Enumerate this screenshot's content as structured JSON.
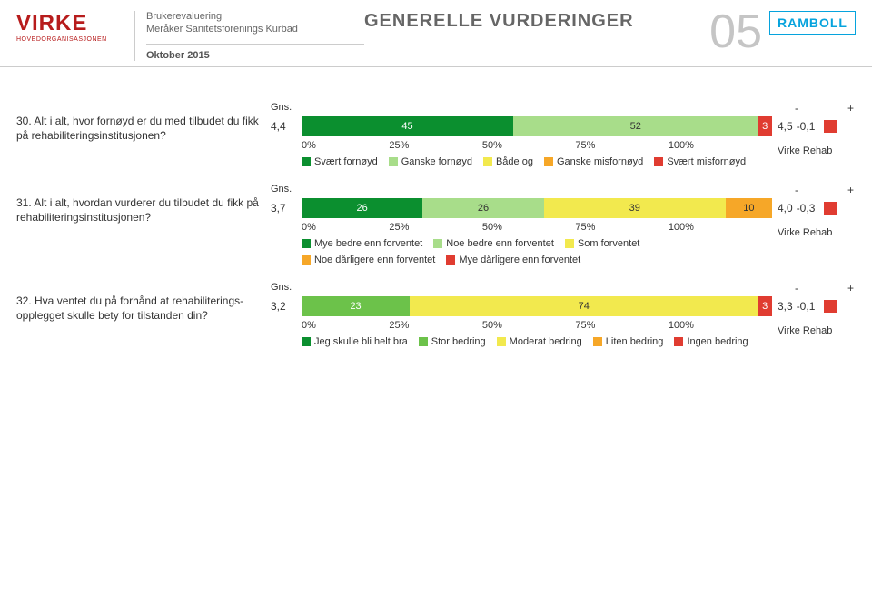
{
  "header": {
    "logo_top": "VIRKE",
    "logo_sub": "HOVEDORGANISASJONEN",
    "line1": "Brukerevaluering",
    "line2": "Meråker Sanitetsforenings Kurbad",
    "line3": "Oktober 2015",
    "title": "GENERELLE VURDERINGER",
    "page_number": "05",
    "ramboll": "RAMBOLL"
  },
  "axis_ticks": [
    "0%",
    "25%",
    "50%",
    "75%",
    "100%"
  ],
  "gns_label": "Gns.",
  "compare_label": "Virke Rehab",
  "pm": {
    "minus": "-",
    "plus": "+"
  },
  "questions": [
    {
      "label": "30. Alt i alt, hvor fornøyd er du med tilbudet du fikk på rehabiliteringsinstitusjonen?",
      "avg": "4,4",
      "cmp_avg": "4,5",
      "diff": "-0,1",
      "diff_color": "#e03c31",
      "segments": [
        {
          "value": 45,
          "color": "c-darkgreen",
          "txt": "45"
        },
        {
          "value": 52,
          "color": "c-lightgreen",
          "txt": "52",
          "dark": true
        },
        {
          "value": 3,
          "color": "c-red",
          "txt": "3"
        }
      ],
      "legend": [
        {
          "color": "c-darkgreen",
          "label": "Svært fornøyd"
        },
        {
          "color": "c-lightgreen",
          "label": "Ganske fornøyd"
        },
        {
          "color": "c-yellow",
          "label": "Både og"
        },
        {
          "color": "c-orange",
          "label": "Ganske misfornøyd"
        },
        {
          "color": "c-red",
          "label": "Svært misfornøyd"
        }
      ]
    },
    {
      "label": "31. Alt i alt, hvordan vurderer du tilbudet du fikk på rehabiliteringsinstitusjonen?",
      "avg": "3,7",
      "cmp_avg": "4,0",
      "diff": "-0,3",
      "diff_color": "#e03c31",
      "segments": [
        {
          "value": 26,
          "color": "c-darkgreen",
          "txt": "26"
        },
        {
          "value": 26,
          "color": "c-lightgreen",
          "txt": "26",
          "dark": true
        },
        {
          "value": 39,
          "color": "c-yellow",
          "txt": "39",
          "dark": true
        },
        {
          "value": 10,
          "color": "c-orange",
          "txt": "10",
          "dark": true
        }
      ],
      "legend": [
        {
          "color": "c-darkgreen",
          "label": "Mye bedre enn forventet"
        },
        {
          "color": "c-lightgreen",
          "label": "Noe bedre enn forventet"
        },
        {
          "color": "c-yellow",
          "label": "Som forventet"
        },
        {
          "color": "c-orange",
          "label": "Noe dårligere enn forventet"
        },
        {
          "color": "c-red",
          "label": "Mye dårligere enn forventet"
        }
      ]
    },
    {
      "label": "32. Hva ventet du på forhånd at rehabiliterings-opplegget skulle bety for tilstanden din?",
      "avg": "3,2",
      "cmp_avg": "3,3",
      "diff": "-0,1",
      "diff_color": "#e03c31",
      "segments": [
        {
          "value": 23,
          "color": "c-green",
          "txt": "23"
        },
        {
          "value": 74,
          "color": "c-yellow",
          "txt": "74",
          "dark": true
        },
        {
          "value": 3,
          "color": "c-red",
          "txt": "3"
        }
      ],
      "legend": [
        {
          "color": "c-darkgreen",
          "label": "Jeg skulle bli helt bra"
        },
        {
          "color": "c-green",
          "label": "Stor bedring"
        },
        {
          "color": "c-yellow",
          "label": "Moderat bedring"
        },
        {
          "color": "c-orange",
          "label": "Liten bedring"
        },
        {
          "color": "c-red",
          "label": "Ingen bedring"
        }
      ]
    }
  ],
  "chart_data": [
    {
      "type": "bar",
      "stacked": true,
      "orientation": "horizontal",
      "title": "Q30 satisfaction distribution",
      "categories": [
        "Svært fornøyd",
        "Ganske fornøyd",
        "Både og",
        "Ganske misfornøyd",
        "Svært misfornøyd"
      ],
      "values": [
        45,
        52,
        0,
        0,
        3
      ],
      "mean": 4.4,
      "benchmark_mean": 4.5,
      "diff": -0.1,
      "xlabel": "%",
      "xlim": [
        0,
        100
      ]
    },
    {
      "type": "bar",
      "stacked": true,
      "orientation": "horizontal",
      "title": "Q31 expectation vs experience",
      "categories": [
        "Mye bedre enn forventet",
        "Noe bedre enn forventet",
        "Som forventet",
        "Noe dårligere enn forventet",
        "Mye dårligere enn forventet"
      ],
      "values": [
        26,
        26,
        39,
        10,
        0
      ],
      "mean": 3.7,
      "benchmark_mean": 4.0,
      "diff": -0.3,
      "xlabel": "%",
      "xlim": [
        0,
        100
      ]
    },
    {
      "type": "bar",
      "stacked": true,
      "orientation": "horizontal",
      "title": "Q32 prior expectation of improvement",
      "categories": [
        "Jeg skulle bli helt bra",
        "Stor bedring",
        "Moderat bedring",
        "Liten bedring",
        "Ingen bedring"
      ],
      "values": [
        0,
        23,
        74,
        0,
        3
      ],
      "mean": 3.2,
      "benchmark_mean": 3.3,
      "diff": -0.1,
      "xlabel": "%",
      "xlim": [
        0,
        100
      ]
    }
  ]
}
